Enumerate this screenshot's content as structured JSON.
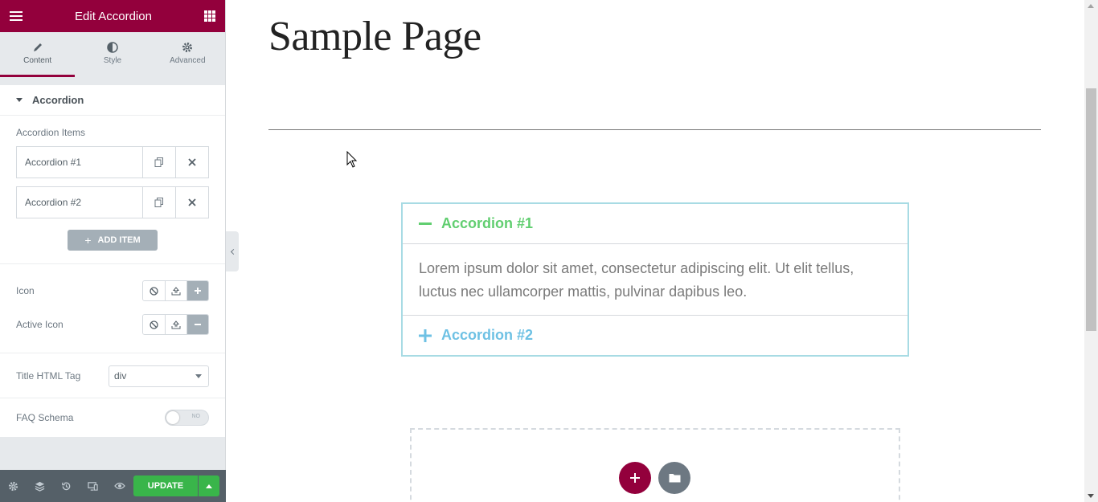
{
  "panel": {
    "title": "Edit Accordion",
    "tabs": [
      {
        "label": "Content",
        "icon": "pencil-icon",
        "active": true
      },
      {
        "label": "Style",
        "icon": "half-circle-icon",
        "active": false
      },
      {
        "label": "Advanced",
        "icon": "gear-icon",
        "active": false
      }
    ],
    "section_title": "Accordion",
    "accordion_items_label": "Accordion Items",
    "items": [
      {
        "title": "Accordion #1"
      },
      {
        "title": "Accordion #2"
      }
    ],
    "add_item_label": "ADD ITEM",
    "icon_label": "Icon",
    "active_icon_label": "Active Icon",
    "title_tag_label": "Title HTML Tag",
    "title_tag_value": "div",
    "faq_label": "FAQ Schema",
    "faq_switch_text": "NO",
    "update_label": "UPDATE"
  },
  "canvas": {
    "page_title": "Sample Page",
    "accordion": {
      "item1_title": "Accordion #1",
      "item1_content": "Lorem ipsum dolor sit amet, consectetur adipiscing elit. Ut elit tellus, luctus nec ullamcorper mattis, pulvinar dapibus leo.",
      "item2_title": "Accordion #2"
    }
  },
  "colors": {
    "brand": "#93003c",
    "active_title": "#61ce70",
    "inactive_title": "#6ec1e4",
    "update": "#39b54a"
  }
}
